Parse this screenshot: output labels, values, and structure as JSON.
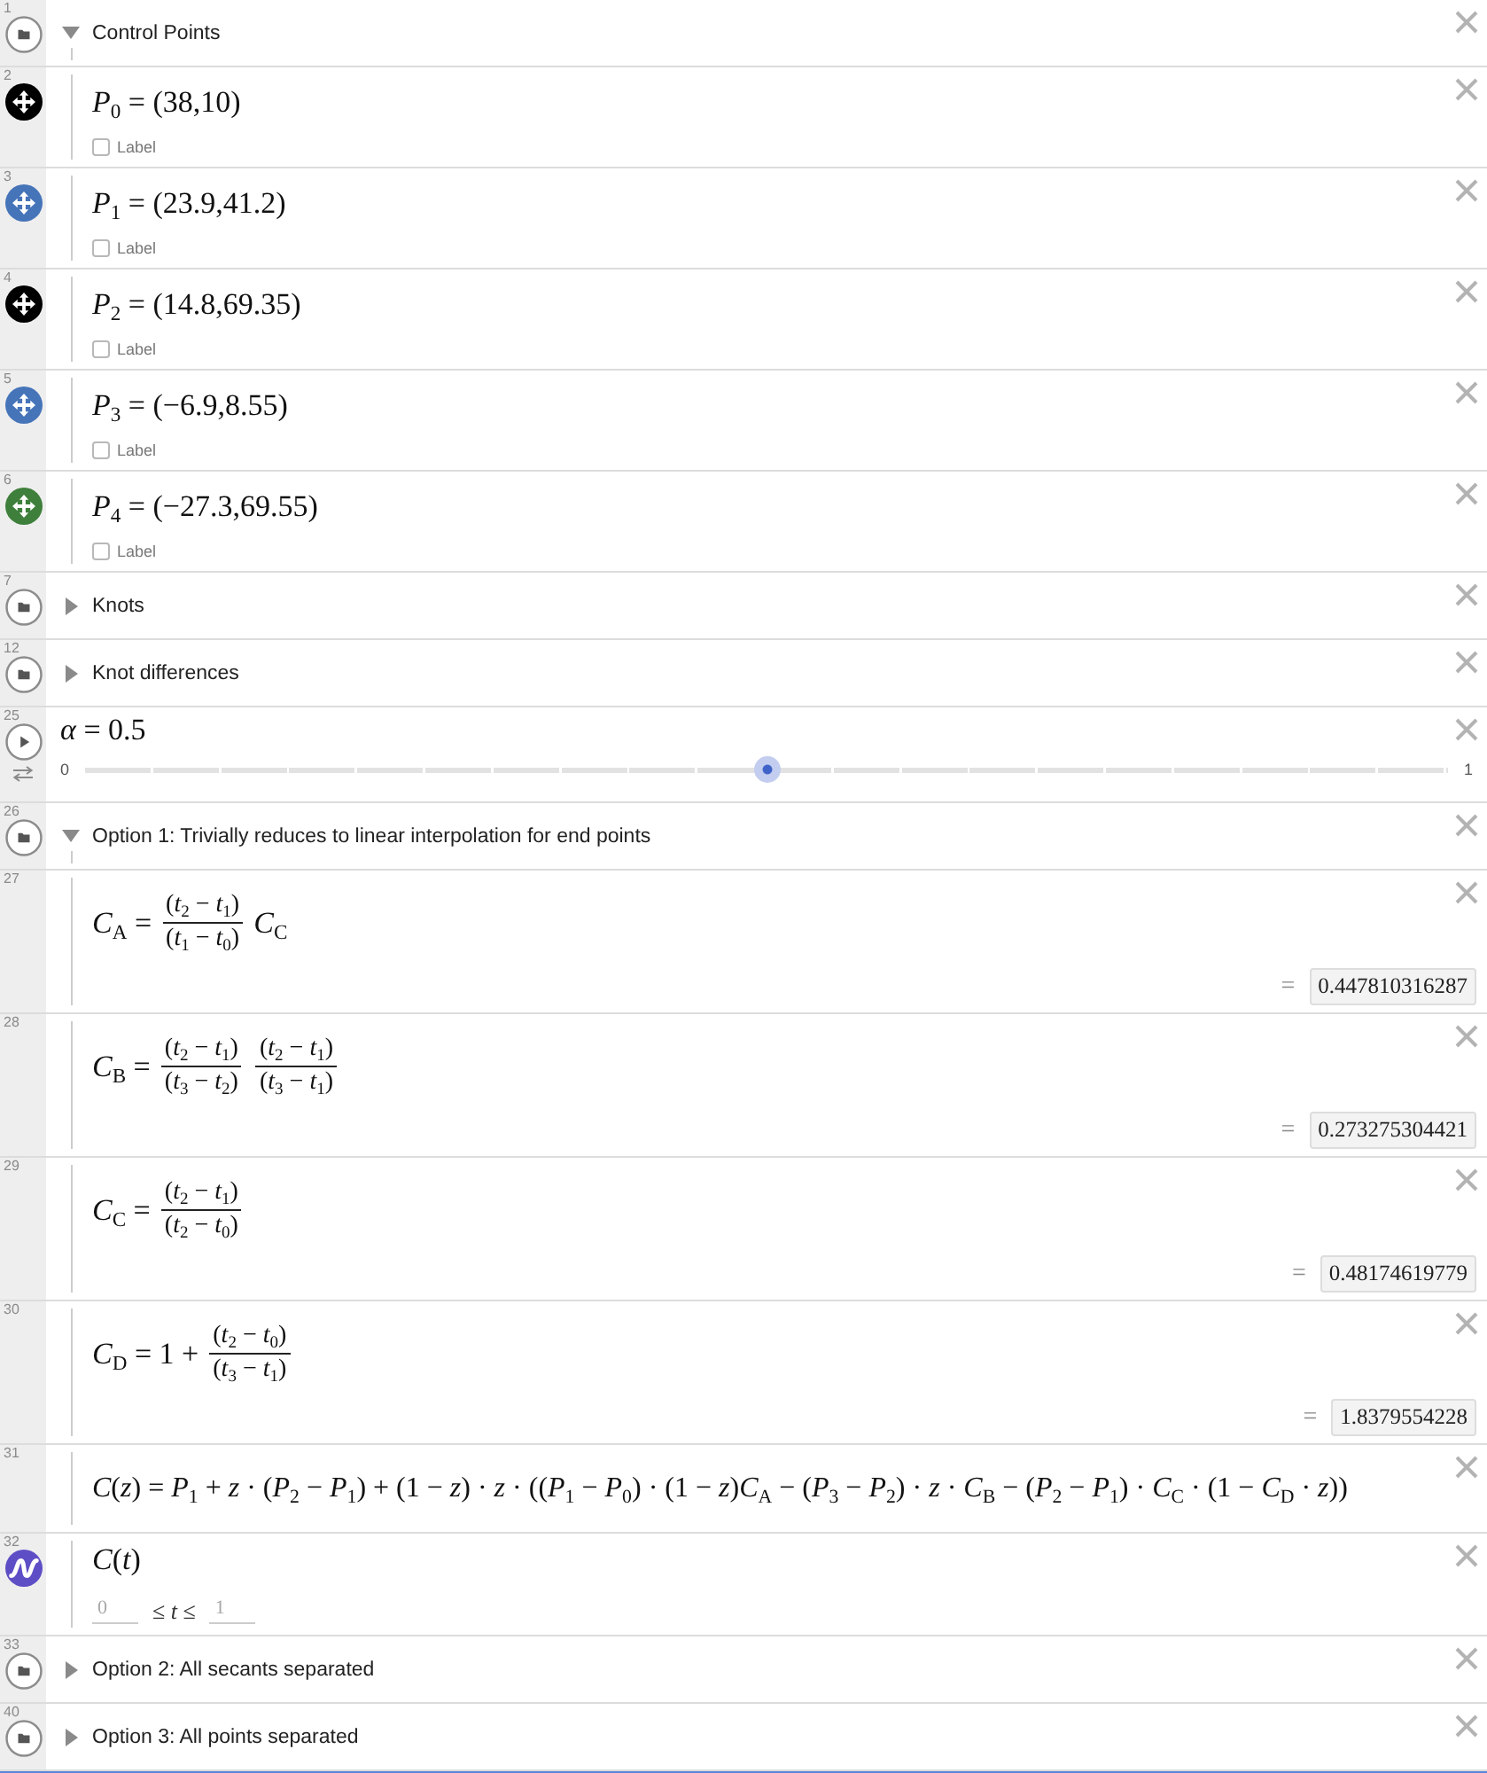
{
  "rows": [
    {
      "kind": "folder",
      "number": "1",
      "title": "Control Points",
      "expanded": true,
      "children": [
        {
          "kind": "point",
          "number": "2",
          "color": "#000000",
          "formula": "*P*$_{0}$ = (38,10)",
          "label": {
            "text": "Label",
            "checked": false
          }
        },
        {
          "kind": "point",
          "number": "3",
          "color": "#4674b9",
          "formula": "*P*$_{1}$ = (23.9,41.2)",
          "label": {
            "text": "Label",
            "checked": false
          }
        },
        {
          "kind": "point",
          "number": "4",
          "color": "#000000",
          "formula": "*P*$_{2}$ = (14.8,69.35)",
          "label": {
            "text": "Label",
            "checked": false
          }
        },
        {
          "kind": "point",
          "number": "5",
          "color": "#4674b9",
          "formula": "*P*$_{3}$ = (−6.9,8.55)",
          "label": {
            "text": "Label",
            "checked": false
          }
        },
        {
          "kind": "point",
          "number": "6",
          "color": "#3e7f3b",
          "formula": "*P*$_{4}$ = (−27.3,69.55)",
          "label": {
            "text": "Label",
            "checked": false
          }
        }
      ]
    },
    {
      "kind": "folder",
      "number": "7",
      "title": "Knots",
      "expanded": false
    },
    {
      "kind": "folder",
      "number": "12",
      "title": "Knot differences",
      "expanded": false
    },
    {
      "kind": "slider",
      "number": "25",
      "formula": "*α* = 0.5",
      "min": "0",
      "max": "1",
      "level": 0.5
    },
    {
      "kind": "folder",
      "number": "26",
      "title": "Option 1: Trivially reduces to linear interpolation for end points",
      "expanded": true,
      "children": [
        {
          "kind": "formula",
          "number": "27",
          "parts": [
            {
              "kind": "text",
              "text": "*C*$_{A}$ ="
            },
            {
              "kind": "frac",
              "numerator": "(*t*$_{2}$ − *t*$_{1}$)",
              "denominator": "(*t*$_{1}$ − *t*$_{0}$)"
            },
            {
              "kind": "text",
              "text": "*C*$_{C}$"
            }
          ],
          "result": {
            "relation": "=",
            "value": "0.447810316287"
          }
        },
        {
          "kind": "formula",
          "number": "28",
          "parts": [
            {
              "kind": "text",
              "text": "*C*$_{B}$ ="
            },
            {
              "kind": "frac",
              "numerator": "(*t*$_{2}$ − *t*$_{1}$)",
              "denominator": "(*t*$_{3}$ − *t*$_{2}$)"
            },
            {
              "kind": "frac",
              "numerator": "(*t*$_{2}$ − *t*$_{1}$)",
              "denominator": "(*t*$_{3}$ − *t*$_{1}$)"
            }
          ],
          "result": {
            "relation": "=",
            "value": "0.273275304421"
          }
        },
        {
          "kind": "formula",
          "number": "29",
          "parts": [
            {
              "kind": "text",
              "text": "*C*$_{C}$ ="
            },
            {
              "kind": "frac",
              "numerator": "(*t*$_{2}$ − *t*$_{1}$)",
              "denominator": "(*t*$_{2}$ − *t*$_{0}$)"
            }
          ],
          "result": {
            "relation": "=",
            "value": "0.48174619779"
          }
        },
        {
          "kind": "formula",
          "number": "30",
          "parts": [
            {
              "kind": "text",
              "text": "*C*$_{D}$ = 1 +"
            },
            {
              "kind": "frac",
              "numerator": "(*t*$_{2}$ − *t*$_{0}$)",
              "denominator": "(*t*$_{3}$ − *t*$_{1}$)"
            }
          ],
          "result": {
            "relation": "=",
            "value": "1.8379554228"
          }
        },
        {
          "kind": "formula",
          "number": "31",
          "parts": [
            {
              "kind": "text",
              "text": "*C*(*z*) = *P*$_{1}$ + *z* · (*P*$_{2}$ − *P*$_{1}$) + (1 − *z*) · *z* · ((*P*$_{1}$ − *P*$_{0}$) · (1 − *z*)*C*$_{A}$ − (*P*$_{3}$ − *P*$_{2}$) · *z* · *C*$_{B}$ − (*P*$_{2}$ − *P*$_{1}$) · *C*$_{C}$ · (1 − *C*$_{D}$ · *z*))"
            }
          ]
        },
        {
          "kind": "curve",
          "number": "32",
          "formula": "*C*(*t*)",
          "range": {
            "start": "0",
            "relation": "≤ *t* ≤",
            "end": "1"
          }
        }
      ]
    },
    {
      "kind": "folder",
      "number": "33",
      "title": "Option 2: All secants separated",
      "expanded": false
    },
    {
      "kind": "folder",
      "number": "40",
      "title": "Option 3: All points separated",
      "expanded": false
    }
  ]
}
